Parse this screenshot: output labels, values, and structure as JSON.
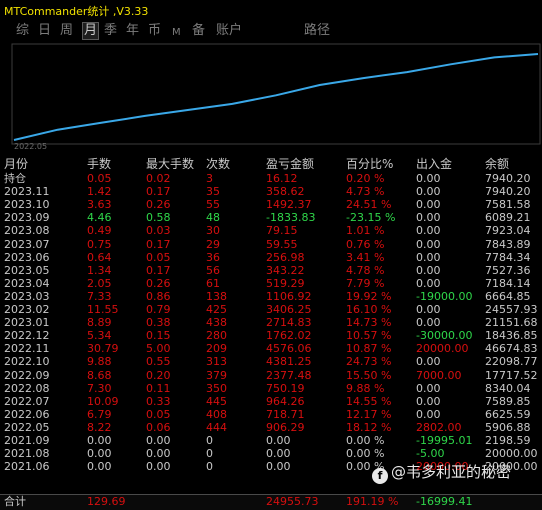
{
  "title": "MTCommander统计 ,V3.33",
  "tabs": [
    "综",
    "日",
    "周",
    "月",
    "季",
    "年",
    "币",
    "M",
    "备",
    "账户",
    "路径"
  ],
  "active_tab": "月",
  "chart": {
    "start_label": "2022.05",
    "line_color": "#3aa8e8",
    "points": [
      0,
      0.12,
      0.2,
      0.28,
      0.35,
      0.42,
      0.52,
      0.64,
      0.72,
      0.79,
      0.88,
      0.96,
      1.0
    ]
  },
  "columns": [
    "月份",
    "手数",
    "最大手数",
    "次数",
    "盈亏金额",
    "百分比%",
    "出入金",
    "余额"
  ],
  "rows": [
    {
      "m": "持仓",
      "lots": "0.05",
      "max": "0.02",
      "n": "3",
      "pnl": "16.12",
      "pct": "0.20 %",
      "io": "0.00",
      "bal": "7940.20",
      "c": "red",
      "ioc": "gray"
    },
    {
      "m": "2023.11",
      "lots": "1.42",
      "max": "0.17",
      "n": "35",
      "pnl": "358.62",
      "pct": "4.73 %",
      "io": "0.00",
      "bal": "7940.20",
      "c": "red",
      "ioc": "gray"
    },
    {
      "m": "2023.10",
      "lots": "3.63",
      "max": "0.26",
      "n": "55",
      "pnl": "1492.37",
      "pct": "24.51 %",
      "io": "0.00",
      "bal": "7581.58",
      "c": "red",
      "ioc": "gray"
    },
    {
      "m": "2023.09",
      "lots": "4.46",
      "max": "0.58",
      "n": "48",
      "pnl": "-1833.83",
      "pct": "-23.15 %",
      "io": "0.00",
      "bal": "6089.21",
      "c": "green",
      "ioc": "gray"
    },
    {
      "m": "2023.08",
      "lots": "0.49",
      "max": "0.03",
      "n": "30",
      "pnl": "79.15",
      "pct": "1.01 %",
      "io": "0.00",
      "bal": "7923.04",
      "c": "red",
      "ioc": "gray"
    },
    {
      "m": "2023.07",
      "lots": "0.75",
      "max": "0.17",
      "n": "29",
      "pnl": "59.55",
      "pct": "0.76 %",
      "io": "0.00",
      "bal": "7843.89",
      "c": "red",
      "ioc": "gray"
    },
    {
      "m": "2023.06",
      "lots": "0.64",
      "max": "0.05",
      "n": "36",
      "pnl": "256.98",
      "pct": "3.41 %",
      "io": "0.00",
      "bal": "7784.34",
      "c": "red",
      "ioc": "gray"
    },
    {
      "m": "2023.05",
      "lots": "1.34",
      "max": "0.17",
      "n": "56",
      "pnl": "343.22",
      "pct": "4.78 %",
      "io": "0.00",
      "bal": "7527.36",
      "c": "red",
      "ioc": "gray"
    },
    {
      "m": "2023.04",
      "lots": "2.05",
      "max": "0.26",
      "n": "61",
      "pnl": "519.29",
      "pct": "7.79 %",
      "io": "0.00",
      "bal": "7184.14",
      "c": "red",
      "ioc": "gray"
    },
    {
      "m": "2023.03",
      "lots": "7.33",
      "max": "0.86",
      "n": "138",
      "pnl": "1106.92",
      "pct": "19.92 %",
      "io": "-19000.00",
      "bal": "6664.85",
      "c": "red",
      "ioc": "green"
    },
    {
      "m": "2023.02",
      "lots": "11.55",
      "max": "0.79",
      "n": "425",
      "pnl": "3406.25",
      "pct": "16.10 %",
      "io": "0.00",
      "bal": "24557.93",
      "c": "red",
      "ioc": "gray"
    },
    {
      "m": "2023.01",
      "lots": "8.89",
      "max": "0.38",
      "n": "438",
      "pnl": "2714.83",
      "pct": "14.73 %",
      "io": "0.00",
      "bal": "21151.68",
      "c": "red",
      "ioc": "gray"
    },
    {
      "m": "2022.12",
      "lots": "5.34",
      "max": "0.15",
      "n": "280",
      "pnl": "1762.02",
      "pct": "10.57 %",
      "io": "-30000.00",
      "bal": "18436.85",
      "c": "red",
      "ioc": "green"
    },
    {
      "m": "2022.11",
      "lots": "30.79",
      "max": "5.00",
      "n": "209",
      "pnl": "4576.06",
      "pct": "10.87 %",
      "io": "20000.00",
      "bal": "46674.83",
      "c": "red",
      "ioc": "red"
    },
    {
      "m": "2022.10",
      "lots": "9.88",
      "max": "0.55",
      "n": "313",
      "pnl": "4381.25",
      "pct": "24.73 %",
      "io": "0.00",
      "bal": "22098.77",
      "c": "red",
      "ioc": "gray"
    },
    {
      "m": "2022.09",
      "lots": "8.68",
      "max": "0.20",
      "n": "379",
      "pnl": "2377.48",
      "pct": "15.50 %",
      "io": "7000.00",
      "bal": "17717.52",
      "c": "red",
      "ioc": "red"
    },
    {
      "m": "2022.08",
      "lots": "7.30",
      "max": "0.11",
      "n": "350",
      "pnl": "750.19",
      "pct": "9.88 %",
      "io": "0.00",
      "bal": "8340.04",
      "c": "red",
      "ioc": "gray"
    },
    {
      "m": "2022.07",
      "lots": "10.09",
      "max": "0.33",
      "n": "445",
      "pnl": "964.26",
      "pct": "14.55 %",
      "io": "0.00",
      "bal": "7589.85",
      "c": "red",
      "ioc": "gray"
    },
    {
      "m": "2022.06",
      "lots": "6.79",
      "max": "0.05",
      "n": "408",
      "pnl": "718.71",
      "pct": "12.17 %",
      "io": "0.00",
      "bal": "6625.59",
      "c": "red",
      "ioc": "gray"
    },
    {
      "m": "2022.05",
      "lots": "8.22",
      "max": "0.06",
      "n": "444",
      "pnl": "906.29",
      "pct": "18.12 %",
      "io": "2802.00",
      "bal": "5906.88",
      "c": "red",
      "ioc": "red"
    },
    {
      "m": "2021.09",
      "lots": "0.00",
      "max": "0.00",
      "n": "0",
      "pnl": "0.00",
      "pct": "0.00 %",
      "io": "-19995.01",
      "bal": "2198.59",
      "c": "gray",
      "ioc": "green"
    },
    {
      "m": "2021.08",
      "lots": "0.00",
      "max": "0.00",
      "n": "0",
      "pnl": "0.00",
      "pct": "0.00 %",
      "io": "-5.00",
      "bal": "20000.00",
      "c": "gray",
      "ioc": "green"
    },
    {
      "m": "2021.06",
      "lots": "0.00",
      "max": "0.00",
      "n": "0",
      "pnl": "0.00",
      "pct": "0.00 %",
      "io": "20000.00",
      "bal": "20000.00",
      "c": "gray",
      "ioc": "red"
    }
  ],
  "footer": {
    "label": "合计",
    "lots": "129.69",
    "pnl": "24955.73",
    "pct": "191.19 %",
    "io": "-16999.41"
  },
  "watermark": "@韦多利亚的秘密",
  "watermark_icon": "zhihu-logo"
}
